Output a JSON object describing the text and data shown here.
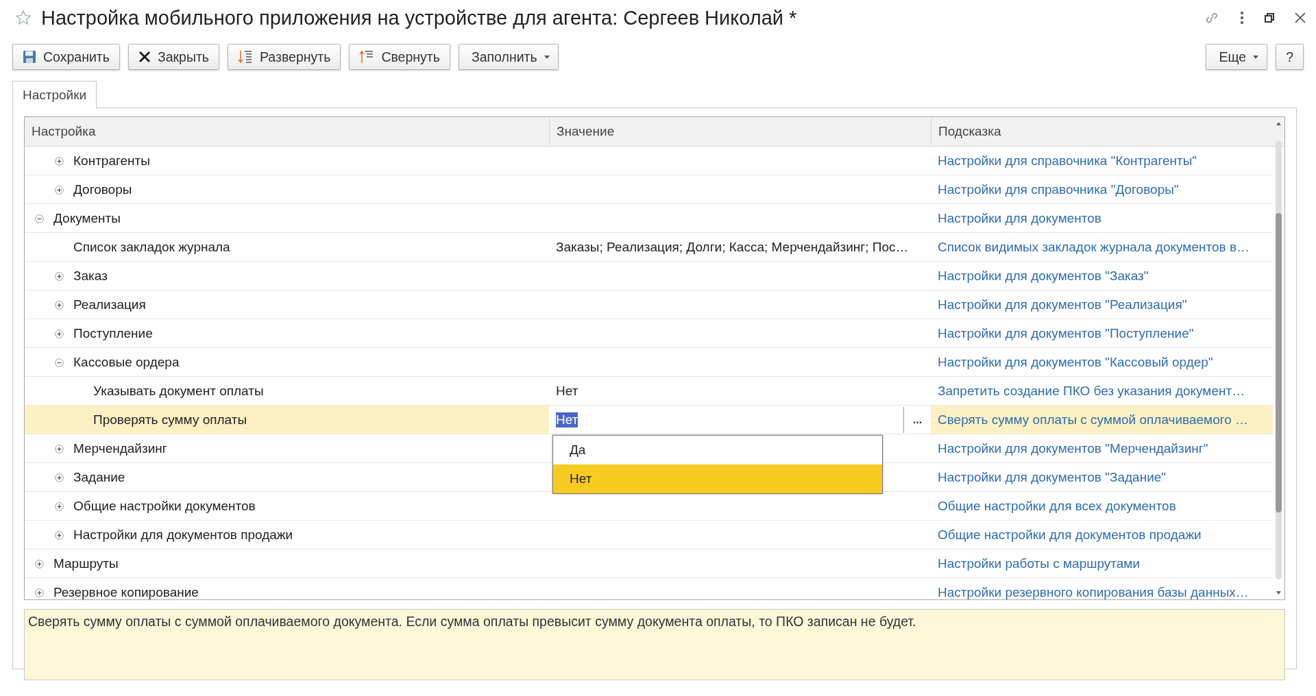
{
  "window": {
    "title": "Настройка мобильного приложения на устройстве для агента: Сергеев Николай *"
  },
  "toolbar": {
    "buttons": [
      {
        "label": "Сохранить",
        "kind": "save"
      },
      {
        "label": "Закрыть",
        "kind": "close"
      },
      {
        "label": "Развернуть",
        "kind": "expand"
      },
      {
        "label": "Свернуть",
        "kind": "collapse"
      },
      {
        "label": "Заполнить",
        "kind": "menu"
      }
    ],
    "right_buttons": [
      {
        "label": "Еще",
        "kind": "menu"
      },
      {
        "label": "?",
        "kind": "plain"
      }
    ]
  },
  "tabs": [
    {
      "label": "Настройки",
      "selected": true
    }
  ],
  "table": {
    "columns": [
      "Настройка",
      "Значение",
      "Подсказка"
    ],
    "tree": [
      {
        "children": [
          {
            "label": "Контрагенты",
            "expanded": false,
            "selected": false,
            "hint": "Настройки для справочника \"Контрагенты\""
          },
          {
            "label": "Договоры",
            "expanded": false,
            "selected": false,
            "hint": "Настройки для справочника \"Договоры\""
          }
        ]
      },
      {
        "label": "Документы",
        "expanded": true,
        "selected": false,
        "hint": "Настройки для документов",
        "children": [
          {
            "label": "Список закладок журнала",
            "selected": false,
            "value": "Заказы; Реализация; Долги; Касса; Мерчендайзинг; Пос…",
            "hint": "Список видимых закладок журнала документов в…"
          },
          {
            "label": "Заказ",
            "expanded": false,
            "selected": false,
            "hint": "Настройки для документов \"Заказ\""
          },
          {
            "label": "Реализация",
            "expanded": false,
            "selected": false,
            "hint": "Настройки для документов \"Реализация\""
          },
          {
            "label": "Поступление",
            "expanded": false,
            "selected": false,
            "hint": "Настройки для документов \"Поступление\""
          },
          {
            "label": "Кассовые ордера",
            "expanded": true,
            "selected": false,
            "hint": "Настройки для документов \"Кассовый ордер\"",
            "children": [
              {
                "label": "Указывать документ оплаты",
                "selected": false,
                "value": "Нет",
                "hint": "Запретить создание ПКО без указания документ…"
              },
              {
                "label": "Проверять сумму оплаты",
                "selected": true,
                "value": "Нет",
                "hint": "Сверять сумму оплаты с суммой оплачиваемого …"
              }
            ]
          },
          {
            "label": "Мерчендайзинг",
            "expanded": false,
            "selected": false,
            "hint": "Настройки для документов \"Мерчендайзинг\""
          },
          {
            "label": "Задание",
            "expanded": false,
            "selected": false,
            "hint": "Настройки для документов \"Задание\""
          },
          {
            "label": "Общие настройки документов",
            "expanded": false,
            "selected": false,
            "hint": "Общие настройки для всех документов"
          },
          {
            "label": "Настройки для документов продажи",
            "expanded": false,
            "selected": false,
            "hint": "Общие настройки для документов продажи"
          }
        ]
      },
      {
        "label": "Маршруты",
        "expanded": false,
        "selected": false,
        "hint": "Настройки работы с маршрутами"
      },
      {
        "label": "Резервное копирование",
        "expanded": false,
        "selected": false,
        "hint": "Настройки резервного копирования базы данных…"
      }
    ]
  },
  "editor": {
    "button": "..."
  },
  "dropdown": {
    "options": [
      {
        "label": "Да",
        "selected": false
      },
      {
        "label": "Нет",
        "selected": true
      }
    ]
  },
  "description": "Сверять сумму оплаты с суммой оплачиваемого документа. Если сумма оплаты превысит сумму документа оплаты, то ПКО записан не будет."
}
